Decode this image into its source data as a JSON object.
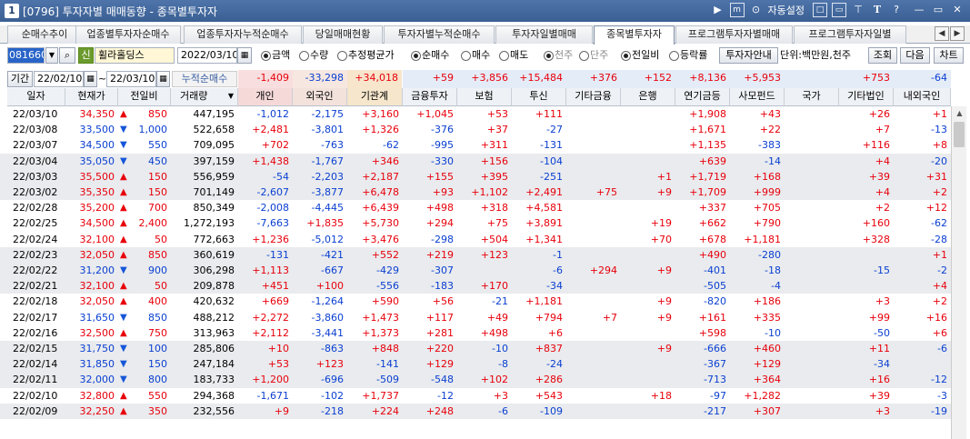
{
  "window": {
    "number": "1",
    "title": "[0796] 투자자별 매매동향 - 종목별투자자",
    "autoset": "자동설정"
  },
  "tabs": [
    "순매수추이",
    "업종별투자자순매수",
    "업종투자자누적순매수",
    "당일매매현황",
    "투자자별누적순매수",
    "투자자일별매매",
    "종목별투자자",
    "프로그램투자자별매매",
    "프로그램투자자일별"
  ],
  "active_tab": "종목별투자자",
  "controls": {
    "code": "081660",
    "code_mark": "신",
    "stock_name": "휠라홀딩스",
    "date": "2022/03/10",
    "from": "22/02/10",
    "to": "22/03/10",
    "cum_label": "누적순매수",
    "period_label": "기간",
    "r_amount": "금액",
    "r_qty": "수량",
    "r_avg": "추정평균가",
    "r_net": "순매수",
    "r_buy": "매수",
    "r_sell": "매도",
    "r_1000": "천주",
    "r_single": "단주",
    "r_prev": "전일비",
    "r_rate": "등락률",
    "btn_info": "투자자안내",
    "unit": "단위:백만원,천주",
    "btn_query": "조회",
    "btn_next": "다음",
    "btn_chart": "차트"
  },
  "sums": [
    "-1,409",
    "-33,298",
    "+34,018",
    "+59",
    "+3,856",
    "+15,484",
    "+376",
    "+152",
    "+8,136",
    "+5,953",
    "",
    "+753",
    "-64"
  ],
  "headers": [
    "일자",
    "현재가",
    "전일비",
    "거래량",
    "개인",
    "외국인",
    "기관계",
    "금융투자",
    "보험",
    "투신",
    "기타금융",
    "은행",
    "연기금등",
    "사모펀드",
    "국가",
    "기타법인",
    "내외국인"
  ],
  "rows": [
    [
      "22/03/10",
      "34,350",
      "u",
      "850",
      "447,195",
      "-1,012",
      "-2,175",
      "+3,160",
      "+1,045",
      "+53",
      "+111",
      "",
      "",
      "+1,908",
      "+43",
      "",
      "+26",
      "+1"
    ],
    [
      "22/03/08",
      "33,500",
      "d",
      "1,000",
      "522,658",
      "+2,481",
      "-3,801",
      "+1,326",
      "-376",
      "+37",
      "-27",
      "",
      "",
      "+1,671",
      "+22",
      "",
      "+7",
      "-13"
    ],
    [
      "22/03/07",
      "34,500",
      "d",
      "550",
      "709,095",
      "+702",
      "-763",
      "-62",
      "-995",
      "+311",
      "-131",
      "",
      "",
      "+1,135",
      "-383",
      "",
      "+116",
      "+8"
    ],
    [
      "22/03/04",
      "35,050",
      "d",
      "450",
      "397,159",
      "+1,438",
      "-1,767",
      "+346",
      "-330",
      "+156",
      "-104",
      "",
      "",
      "+639",
      "-14",
      "",
      "+4",
      "-20"
    ],
    [
      "22/03/03",
      "35,500",
      "u",
      "150",
      "556,959",
      "-54",
      "-2,203",
      "+2,187",
      "+155",
      "+395",
      "-251",
      "",
      "+1",
      "+1,719",
      "+168",
      "",
      "+39",
      "+31"
    ],
    [
      "22/03/02",
      "35,350",
      "u",
      "150",
      "701,149",
      "-2,607",
      "-3,877",
      "+6,478",
      "+93",
      "+1,102",
      "+2,491",
      "+75",
      "+9",
      "+1,709",
      "+999",
      "",
      "+4",
      "+2"
    ],
    [
      "22/02/28",
      "35,200",
      "u",
      "700",
      "850,349",
      "-2,008",
      "-4,445",
      "+6,439",
      "+498",
      "+318",
      "+4,581",
      "",
      "",
      "+337",
      "+705",
      "",
      "+2",
      "+12"
    ],
    [
      "22/02/25",
      "34,500",
      "u",
      "2,400",
      "1,272,193",
      "-7,663",
      "+1,835",
      "+5,730",
      "+294",
      "+75",
      "+3,891",
      "",
      "+19",
      "+662",
      "+790",
      "",
      "+160",
      "-62"
    ],
    [
      "22/02/24",
      "32,100",
      "u",
      "50",
      "772,663",
      "+1,236",
      "-5,012",
      "+3,476",
      "-298",
      "+504",
      "+1,341",
      "",
      "+70",
      "+678",
      "+1,181",
      "",
      "+328",
      "-28"
    ],
    [
      "22/02/23",
      "32,050",
      "u",
      "850",
      "360,619",
      "-131",
      "-421",
      "+552",
      "+219",
      "+123",
      "-1",
      "",
      "",
      "+490",
      "-280",
      "",
      "",
      "+1"
    ],
    [
      "22/02/22",
      "31,200",
      "d",
      "900",
      "306,298",
      "+1,113",
      "-667",
      "-429",
      "-307",
      "",
      "-6",
      "+294",
      "+9",
      "-401",
      "-18",
      "",
      "-15",
      "-2"
    ],
    [
      "22/02/21",
      "32,100",
      "u",
      "50",
      "209,878",
      "+451",
      "+100",
      "-556",
      "-183",
      "+170",
      "-34",
      "",
      "",
      "-505",
      "-4",
      "",
      "",
      "+4"
    ],
    [
      "22/02/18",
      "32,050",
      "u",
      "400",
      "420,632",
      "+669",
      "-1,264",
      "+590",
      "+56",
      "-21",
      "+1,181",
      "",
      "+9",
      "-820",
      "+186",
      "",
      "+3",
      "+2"
    ],
    [
      "22/02/17",
      "31,650",
      "d",
      "850",
      "488,212",
      "+2,272",
      "-3,860",
      "+1,473",
      "+117",
      "+49",
      "+794",
      "+7",
      "+9",
      "+161",
      "+335",
      "",
      "+99",
      "+16"
    ],
    [
      "22/02/16",
      "32,500",
      "u",
      "750",
      "313,963",
      "+2,112",
      "-3,441",
      "+1,373",
      "+281",
      "+498",
      "+6",
      "",
      "",
      "+598",
      "-10",
      "",
      "-50",
      "+6"
    ],
    [
      "22/02/15",
      "31,750",
      "d",
      "100",
      "285,806",
      "+10",
      "-863",
      "+848",
      "+220",
      "-10",
      "+837",
      "",
      "+9",
      "-666",
      "+460",
      "",
      "+11",
      "-6"
    ],
    [
      "22/02/14",
      "31,850",
      "d",
      "150",
      "247,184",
      "+53",
      "+123",
      "-141",
      "+129",
      "-8",
      "-24",
      "",
      "",
      "-367",
      "+129",
      "",
      "-34",
      ""
    ],
    [
      "22/02/11",
      "32,000",
      "d",
      "800",
      "183,733",
      "+1,200",
      "-696",
      "-509",
      "-548",
      "+102",
      "+286",
      "",
      "",
      "-713",
      "+364",
      "",
      "+16",
      "-12"
    ],
    [
      "22/02/10",
      "32,800",
      "u",
      "550",
      "294,368",
      "-1,671",
      "-102",
      "+1,737",
      "-12",
      "+3",
      "+543",
      "",
      "+18",
      "-97",
      "+1,282",
      "",
      "+39",
      "-3"
    ],
    [
      "22/02/09",
      "32,250",
      "u",
      "350",
      "232,556",
      "+9",
      "-218",
      "+224",
      "+248",
      "-6",
      "-109",
      "",
      "",
      "-217",
      "+307",
      "",
      "+3",
      "-19"
    ]
  ],
  "colors": {
    "titlebar": "#3f6399",
    "sum_indiv": "#f8dede",
    "sum_foreign": "#f6e7e1",
    "sum_inst": "#f7e5cc",
    "sum_rest": "#e4ecf8",
    "hdr_indiv": "#f5d9d9",
    "hdr_foreign": "#f3e2dc",
    "hdr_inst": "#f5e6cc",
    "row_alt": "#e9ebee",
    "up": "#e8000b",
    "down": "#0a3fd1"
  },
  "icons": [
    "window-number-icon",
    "arrow-right-icon",
    "memo-icon",
    "autoset-icon",
    "window-mode-icon",
    "minimize-window-icon",
    "pin-icon",
    "font-size-icon",
    "help-icon",
    "minimize-icon",
    "restore-icon",
    "close-icon",
    "search-icon",
    "calendar-icon",
    "sort-down-icon",
    "triangle-up-icon",
    "triangle-down-icon"
  ]
}
